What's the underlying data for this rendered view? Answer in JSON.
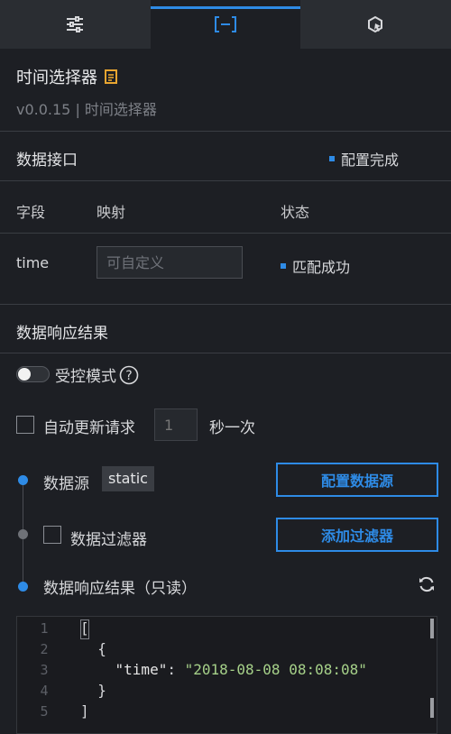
{
  "tabs": [
    {
      "icon": "sliders-icon",
      "active": false
    },
    {
      "icon": "data-bracket-icon",
      "active": true
    },
    {
      "icon": "interaction-icon",
      "active": false
    }
  ],
  "component": {
    "title": "时间选择器",
    "subtitle": "v0.0.15 | 时间选择器",
    "title_icon": "document-icon"
  },
  "data_interface": {
    "title": "数据接口",
    "status": "配置完成",
    "columns": [
      "字段",
      "映射",
      "状态"
    ],
    "rows": [
      {
        "field": "time",
        "mapping_placeholder": "可自定义",
        "status": "匹配成功"
      }
    ]
  },
  "response": {
    "title": "数据响应结果",
    "controlled_mode_label": "受控模式",
    "controlled_mode_on": false,
    "auto_update_label": "自动更新请求",
    "auto_update_checked": false,
    "interval_placeholder": "1",
    "interval_unit": "秒一次",
    "datasource_label": "数据源",
    "datasource_type": "static",
    "config_button": "配置数据源",
    "filter_label": "数据过滤器",
    "filter_checked": false,
    "add_filter_button": "添加过滤器",
    "result_label": "数据响应结果（只读）"
  },
  "code": {
    "line_numbers": [
      "1",
      "2",
      "3",
      "4",
      "5"
    ],
    "line1": "[",
    "line2": "  {",
    "line3_key": "\"time\"",
    "line3_sep": ": ",
    "line3_value": "\"2018-08-08 08:08:08\"",
    "line4": "  }",
    "line5": "]"
  },
  "colors": {
    "accent": "#2e8be6",
    "background": "#1d1f24",
    "code_string": "#a6d189"
  }
}
